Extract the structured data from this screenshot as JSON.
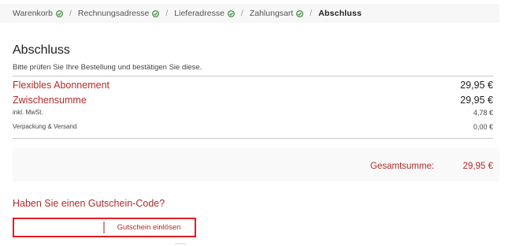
{
  "breadcrumb": {
    "steps": [
      {
        "label": "Warenkorb",
        "done": true
      },
      {
        "label": "Rechnungsadresse",
        "done": true
      },
      {
        "label": "Lieferadresse",
        "done": true
      },
      {
        "label": "Zahlungsart",
        "done": true
      }
    ],
    "separator": "/",
    "current": "Abschluss"
  },
  "page": {
    "title": "Abschluss",
    "subtitle": "Bitte prüfen Sie Ihre Bestellung und bestätigen Sie diese."
  },
  "summary": {
    "product_label": "Flexibles Abonnement",
    "product_price": "29,95 €",
    "subtotal_label": "Zwischensumme",
    "subtotal_value": "29,95 €",
    "tax_label": "inkl. MwSt.",
    "tax_value": "4,78 €",
    "shipping_label": "Verpackung & Versand",
    "shipping_value": "0,00 €",
    "total_label": "Gesamtsumme:",
    "total_value": "29,95 €"
  },
  "voucher": {
    "title": "Haben Sie einen Gutschein-Code?",
    "input_value": "",
    "button_label": "Gutschein einlösen"
  },
  "colors": {
    "accent": "#b52a2a",
    "check": "#3c8a3c",
    "highlight": "#e31e24"
  }
}
